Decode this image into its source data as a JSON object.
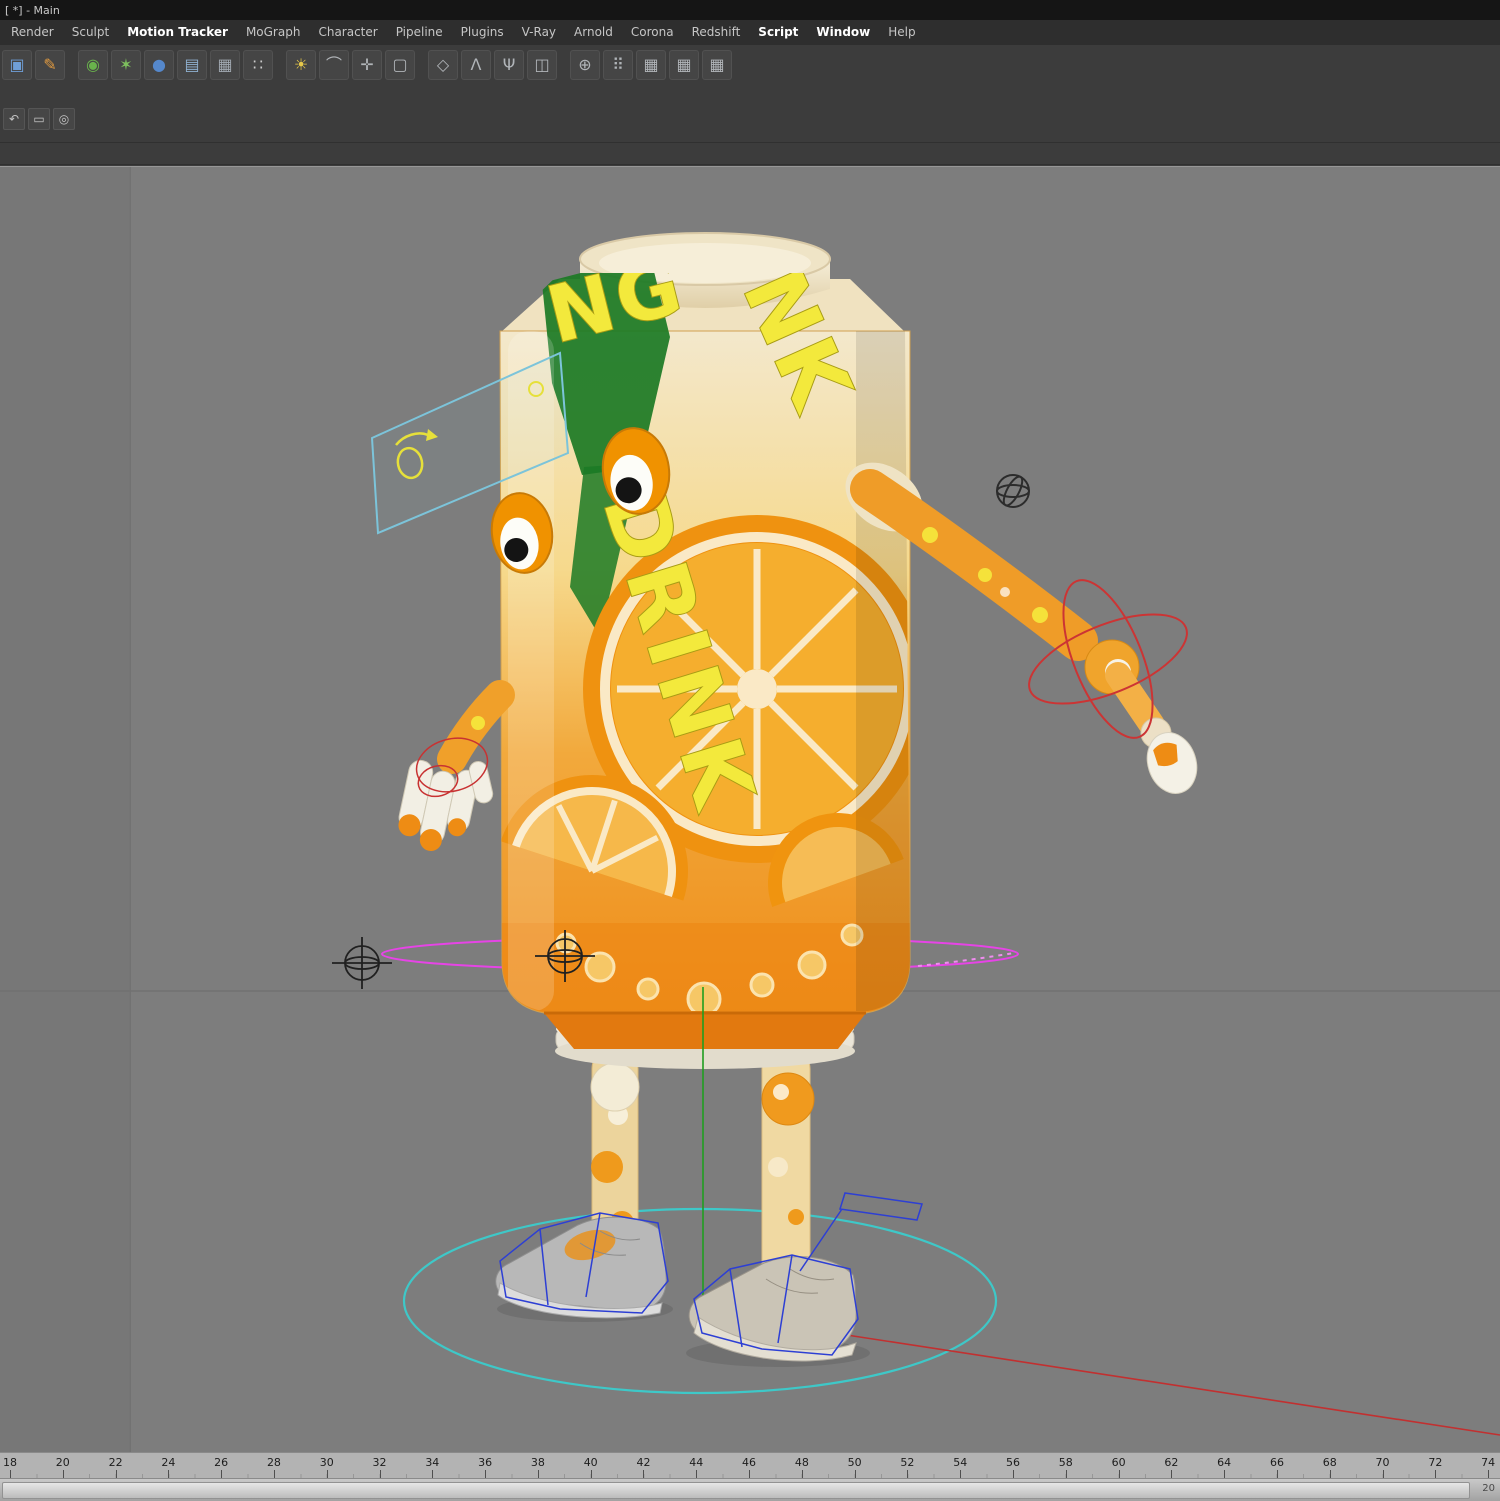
{
  "window": {
    "title": "[ *] - Main"
  },
  "menu": {
    "items": [
      {
        "label": "Render",
        "em": false
      },
      {
        "label": "Sculpt",
        "em": false
      },
      {
        "label": "Motion Tracker",
        "em": true
      },
      {
        "label": "MoGraph",
        "em": false
      },
      {
        "label": "Character",
        "em": false
      },
      {
        "label": "Pipeline",
        "em": false
      },
      {
        "label": "Plugins",
        "em": false
      },
      {
        "label": "V-Ray",
        "em": false
      },
      {
        "label": "Arnold",
        "em": false
      },
      {
        "label": "Corona",
        "em": false
      },
      {
        "label": "Redshift",
        "em": false
      },
      {
        "label": "Script",
        "em": true
      },
      {
        "label": "Window",
        "em": true
      },
      {
        "label": "Help",
        "em": false
      }
    ]
  },
  "toolbar": {
    "icons": [
      {
        "name": "cube-tool",
        "glyph": "▣",
        "color": "#6f9fd8"
      },
      {
        "name": "brush-tool",
        "glyph": "✎",
        "color": "#e09a40"
      },
      {
        "sep": true
      },
      {
        "name": "spheres-tool",
        "glyph": "◉",
        "color": "#69b34c"
      },
      {
        "name": "atom-tool",
        "glyph": "✶",
        "color": "#7ec05e"
      },
      {
        "name": "ball-tool",
        "glyph": "●",
        "color": "#5588cc"
      },
      {
        "name": "grid-array-tool",
        "glyph": "▤",
        "color": "#8fb0d0"
      },
      {
        "name": "camera-tool",
        "glyph": "▦",
        "color": "#a0a8b0"
      },
      {
        "name": "dots-tool",
        "glyph": "∷",
        "color": "#cccccc"
      },
      {
        "sep": true
      },
      {
        "name": "light-tool",
        "glyph": "☀",
        "color": "#e6c84a"
      },
      {
        "name": "spline-tool",
        "glyph": "⌒",
        "color": "#b0b4b8"
      },
      {
        "name": "axis-tool",
        "glyph": "✛",
        "color": "#b0b4b8"
      },
      {
        "name": "wire-cube-tool",
        "glyph": "▢",
        "color": "#b0b4b8"
      },
      {
        "sep": true
      },
      {
        "name": "polygon-tool",
        "glyph": "◇",
        "color": "#b0b4b8"
      },
      {
        "name": "character-rig-tool",
        "glyph": "Λ",
        "color": "#b0b4b8"
      },
      {
        "name": "joint-chain-tool",
        "glyph": "Ψ",
        "color": "#b0b4b8"
      },
      {
        "name": "mirror-tool",
        "glyph": "◫",
        "color": "#b0b4b8"
      },
      {
        "sep": true
      },
      {
        "name": "weights-tool",
        "glyph": "⊕",
        "color": "#b0b4b8"
      },
      {
        "name": "cluster-tool",
        "glyph": "⠿",
        "color": "#b0b4b8"
      },
      {
        "name": "grid-a-tool",
        "glyph": "▦",
        "color": "#b0b4b8"
      },
      {
        "name": "grid-b-tool",
        "glyph": "▦",
        "color": "#b0b4b8"
      },
      {
        "name": "grid-c-tool",
        "glyph": "▦",
        "color": "#b0b4b8"
      }
    ]
  },
  "subtoolbar": {
    "icons": [
      {
        "name": "mini-undo",
        "glyph": "↶"
      },
      {
        "name": "mini-frame",
        "glyph": "▭"
      },
      {
        "name": "mini-target",
        "glyph": "◎"
      }
    ]
  },
  "scene": {
    "can_text_main": "DRINK",
    "can_text_fragment_top": "NG",
    "can_text_fragment_right": "NK",
    "colors": {
      "viewport_bg": "#7d7d7d",
      "ground_circle_cyan": "#3ec8c8",
      "hip_ring_magenta": "#e644e6",
      "selection_wire_blue": "#2d3fd4",
      "gizmo_red": "#cc3434",
      "axis_green": "#1f9e1f",
      "axis_red": "#c23030",
      "can_orange": "#ef9520",
      "label_yellow": "#f3e93c"
    }
  },
  "timeline": {
    "ticks": [
      18,
      20,
      22,
      24,
      26,
      28,
      30,
      32,
      34,
      36,
      38,
      40,
      42,
      44,
      46,
      48,
      50,
      52,
      54,
      56,
      58,
      60,
      62,
      64,
      66,
      68,
      70,
      72,
      74
    ]
  },
  "bottombar": {
    "right_label": "20"
  }
}
